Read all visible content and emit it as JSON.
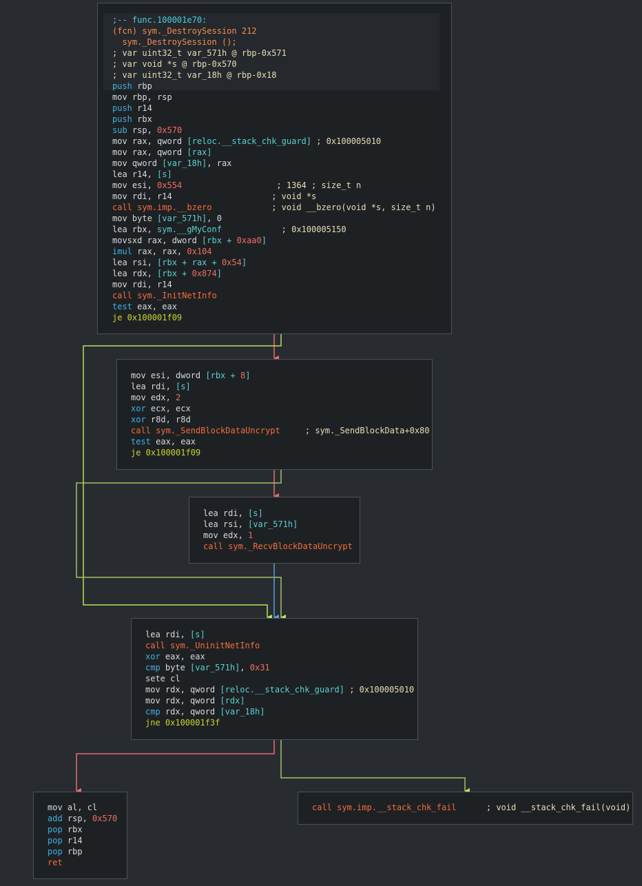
{
  "colors": {
    "background": "#282c30",
    "block_bg": "#1e2124",
    "block_border": "#4d5257",
    "text": "#d7dadd",
    "arith": "#3fb0e0",
    "call": "#f36c3b",
    "jump": "#c9d42c",
    "number": "#ee6e63",
    "variable": "#5ad0ce",
    "symbol": "#f48c50",
    "comment": "#e9dcb6",
    "edge_true": "#b6e25a",
    "edge_false": "#e86c6c",
    "edge_uncond": "#5ca0d3"
  },
  "blocks": [
    {
      "id": "block-0x100001e70",
      "lines": [
        [
          {
            "t": ";-- func.100001e70:",
            "c": "comment"
          }
        ],
        [
          {
            "t": "(fcn) sym._DestroySession 212",
            "c": "sig"
          }
        ],
        [
          {
            "t": "  sym._DestroySession ();",
            "c": "sig"
          }
        ],
        [
          {
            "t": "; var uint32_t var_571h @ rbp-0x571",
            "c": "cmt"
          }
        ],
        [
          {
            "t": "; var void *s @ rbp-0x570",
            "c": "cmt"
          }
        ],
        [
          {
            "t": "; var uint32_t var_18h @ rbp-0x18",
            "c": "cmt"
          }
        ],
        [
          {
            "t": "push",
            "c": "arith"
          },
          {
            "t": " rbp",
            "c": "text"
          }
        ],
        [
          {
            "t": "mov rbp, rsp",
            "c": "text"
          }
        ],
        [
          {
            "t": "push",
            "c": "arith"
          },
          {
            "t": " r14",
            "c": "text"
          }
        ],
        [
          {
            "t": "push",
            "c": "arith"
          },
          {
            "t": " rbx",
            "c": "text"
          }
        ],
        [
          {
            "t": "sub",
            "c": "arith"
          },
          {
            "t": " rsp, ",
            "c": "text"
          },
          {
            "t": "0x570",
            "c": "num"
          }
        ],
        [
          {
            "t": "mov rax, qword ",
            "c": "text"
          },
          {
            "t": "[reloc.__stack_chk_guard]",
            "c": "var"
          },
          {
            "t": " ; 0x100005010",
            "c": "cmt"
          }
        ],
        [
          {
            "t": "mov rax, qword ",
            "c": "text"
          },
          {
            "t": "[rax]",
            "c": "var"
          }
        ],
        [
          {
            "t": "mov qword ",
            "c": "text"
          },
          {
            "t": "[var_18h]",
            "c": "var"
          },
          {
            "t": ", rax",
            "c": "text"
          }
        ],
        [
          {
            "t": "lea r14, ",
            "c": "text"
          },
          {
            "t": "[s]",
            "c": "var"
          }
        ],
        [
          {
            "t": "mov esi, ",
            "c": "text"
          },
          {
            "t": "0x554",
            "c": "num"
          },
          {
            "t": "                   ; 1364 ; size_t n",
            "c": "cmt"
          }
        ],
        [
          {
            "t": "mov rdi, r14",
            "c": "text"
          },
          {
            "t": "                    ; void *s",
            "c": "cmt"
          }
        ],
        [
          {
            "t": "call sym.imp.__bzero",
            "c": "call"
          },
          {
            "t": "            ; void __bzero(void *s, size_t n)",
            "c": "cmt"
          }
        ],
        [
          {
            "t": "mov byte ",
            "c": "text"
          },
          {
            "t": "[var_571h]",
            "c": "var"
          },
          {
            "t": ", 0",
            "c": "text"
          }
        ],
        [
          {
            "t": "lea rbx, ",
            "c": "text"
          },
          {
            "t": "sym.__gMyConf",
            "c": "var"
          },
          {
            "t": "            ; 0x100005150",
            "c": "cmt"
          }
        ],
        [
          {
            "t": "movsxd rax, dword ",
            "c": "text"
          },
          {
            "t": "[rbx + ",
            "c": "var"
          },
          {
            "t": "0xaa0",
            "c": "num"
          },
          {
            "t": "]",
            "c": "var"
          }
        ],
        [
          {
            "t": "imul",
            "c": "arith"
          },
          {
            "t": " rax, rax, ",
            "c": "text"
          },
          {
            "t": "0x104",
            "c": "num"
          }
        ],
        [
          {
            "t": "lea rsi, ",
            "c": "text"
          },
          {
            "t": "[rbx + rax + ",
            "c": "var"
          },
          {
            "t": "0x54",
            "c": "num"
          },
          {
            "t": "]",
            "c": "var"
          }
        ],
        [
          {
            "t": "lea rdx, ",
            "c": "text"
          },
          {
            "t": "[rbx + ",
            "c": "var"
          },
          {
            "t": "0x874",
            "c": "num"
          },
          {
            "t": "]",
            "c": "var"
          }
        ],
        [
          {
            "t": "mov rdi, r14",
            "c": "text"
          }
        ],
        [
          {
            "t": "call sym._InitNetInfo",
            "c": "call"
          }
        ],
        [
          {
            "t": "test",
            "c": "arith"
          },
          {
            "t": " eax, eax",
            "c": "text"
          }
        ],
        [
          {
            "t": "je 0x100001f09",
            "c": "jmp"
          }
        ]
      ]
    },
    {
      "id": "block-send",
      "lines": [
        [
          {
            "t": "mov esi, dword ",
            "c": "text"
          },
          {
            "t": "[rbx + ",
            "c": "var"
          },
          {
            "t": "8",
            "c": "num"
          },
          {
            "t": "]",
            "c": "var"
          }
        ],
        [
          {
            "t": "lea rdi, ",
            "c": "text"
          },
          {
            "t": "[s]",
            "c": "var"
          }
        ],
        [
          {
            "t": "mov edx, ",
            "c": "text"
          },
          {
            "t": "2",
            "c": "num"
          }
        ],
        [
          {
            "t": "xor",
            "c": "arith"
          },
          {
            "t": " ecx, ecx",
            "c": "text"
          }
        ],
        [
          {
            "t": "xor",
            "c": "arith"
          },
          {
            "t": " r8d, r8d",
            "c": "text"
          }
        ],
        [
          {
            "t": "call sym._SendBlockDataUncrypt",
            "c": "call"
          },
          {
            "t": "     ; sym._SendBlockData+0x80",
            "c": "cmt"
          }
        ],
        [
          {
            "t": "test",
            "c": "arith"
          },
          {
            "t": " eax, eax",
            "c": "text"
          }
        ],
        [
          {
            "t": "je 0x100001f09",
            "c": "jmp"
          }
        ]
      ]
    },
    {
      "id": "block-recv",
      "lines": [
        [
          {
            "t": "lea rdi, ",
            "c": "text"
          },
          {
            "t": "[s]",
            "c": "var"
          }
        ],
        [
          {
            "t": "lea rsi, ",
            "c": "text"
          },
          {
            "t": "[var_571h]",
            "c": "var"
          }
        ],
        [
          {
            "t": "mov edx, ",
            "c": "text"
          },
          {
            "t": "1",
            "c": "num"
          }
        ],
        [
          {
            "t": "call sym._RecvBlockDataUncrypt",
            "c": "call"
          }
        ]
      ]
    },
    {
      "id": "block-0x100001f09",
      "lines": [
        [
          {
            "t": "lea rdi, ",
            "c": "text"
          },
          {
            "t": "[s]",
            "c": "var"
          }
        ],
        [
          {
            "t": "call sym._UninitNetInfo",
            "c": "call"
          }
        ],
        [
          {
            "t": "xor",
            "c": "arith"
          },
          {
            "t": " eax, eax",
            "c": "text"
          }
        ],
        [
          {
            "t": "cmp",
            "c": "arith"
          },
          {
            "t": " byte ",
            "c": "text"
          },
          {
            "t": "[var_571h]",
            "c": "var"
          },
          {
            "t": ", ",
            "c": "text"
          },
          {
            "t": "0x31",
            "c": "num"
          }
        ],
        [
          {
            "t": "sete cl",
            "c": "text"
          }
        ],
        [
          {
            "t": "mov rdx, qword ",
            "c": "text"
          },
          {
            "t": "[reloc.__stack_chk_guard]",
            "c": "var"
          },
          {
            "t": " ; 0x100005010",
            "c": "cmt"
          }
        ],
        [
          {
            "t": "mov rdx, qword ",
            "c": "text"
          },
          {
            "t": "[rdx]",
            "c": "var"
          }
        ],
        [
          {
            "t": "cmp",
            "c": "arith"
          },
          {
            "t": " rdx, qword ",
            "c": "text"
          },
          {
            "t": "[var_18h]",
            "c": "var"
          }
        ],
        [
          {
            "t": "jne 0x100001f3f",
            "c": "jmp"
          }
        ]
      ]
    },
    {
      "id": "block-ret",
      "lines": [
        [
          {
            "t": "mov al, cl",
            "c": "text"
          }
        ],
        [
          {
            "t": "add",
            "c": "arith"
          },
          {
            "t": " rsp, ",
            "c": "text"
          },
          {
            "t": "0x570",
            "c": "num"
          }
        ],
        [
          {
            "t": "pop",
            "c": "arith"
          },
          {
            "t": " rbx",
            "c": "text"
          }
        ],
        [
          {
            "t": "pop",
            "c": "arith"
          },
          {
            "t": " r14",
            "c": "text"
          }
        ],
        [
          {
            "t": "pop",
            "c": "arith"
          },
          {
            "t": " rbp",
            "c": "text"
          }
        ],
        [
          {
            "t": "ret",
            "c": "call"
          }
        ]
      ]
    },
    {
      "id": "block-0x100001f3f",
      "lines": [
        [
          {
            "t": "call sym.imp.__stack_chk_fail",
            "c": "call"
          },
          {
            "t": "      ; void __stack_chk_fail(void)",
            "c": "cmt"
          }
        ]
      ]
    }
  ]
}
